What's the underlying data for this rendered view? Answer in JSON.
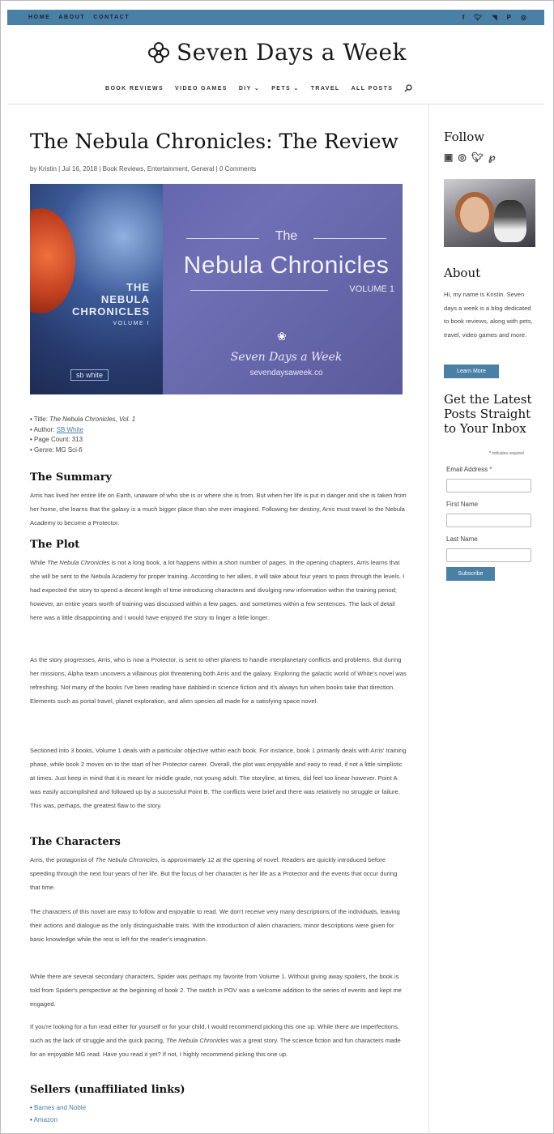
{
  "topbar": {
    "nav": [
      "HOME",
      "ABOUT",
      "CONTACT"
    ],
    "social_icons": [
      "facebook-icon",
      "twitter-icon",
      "rss-icon",
      "pinterest-icon",
      "instagram-icon"
    ]
  },
  "header": {
    "site_title": "Seven Days a Week",
    "nav": [
      "BOOK REVIEWS",
      "VIDEO GAMES",
      "DIY ⌄",
      "PETS ⌄",
      "TRAVEL",
      "ALL POSTS"
    ]
  },
  "article": {
    "title": "The Nebula Chronicles: The Review",
    "meta": {
      "by": "by Kristin",
      "date": "Jul 16, 2018",
      "categories": "Book Reviews, Entertainment, General",
      "comments": "0 Comments"
    },
    "banner": {
      "cover_title_1": "THE",
      "cover_title_2": "NEBULA",
      "cover_title_3": "CHRONICLES",
      "cover_volume": "VOLUME I",
      "cover_author": "sb white",
      "the": "The",
      "name": "Nebula Chronicles",
      "volume": "VOLUME 1",
      "brand": "Seven Days a Week",
      "url": "sevendaysaweek.co"
    },
    "facts": {
      "title_label": "Title: ",
      "title_value": "The Nebula Chronicles, Vol. 1",
      "author_label": "Author: ",
      "author_value": "SB White",
      "pages": "Page Count: 313",
      "genre": "Genre: MG Sci-fi"
    },
    "summary_heading": "The Summary",
    "summary": "Arris has lived her entire life on Earth, unaware of who she is or where she is from. But when her life is put in danger and she is taken from her home, she learns that the galaxy is a much bigger place than she ever imagined. Following her destiny, Arris must travel to the Nebula Academy to become a Protector.",
    "plot_heading": "The Plot",
    "plot_1_pre": "While ",
    "plot_1_italic": "The Nebula Chronicles",
    "plot_1_post": " is not a long book, a lot happens within a short number of pages. In the opening chapters, Arris learns that she will be sent to the Nebula Academy for proper training. According to her allies, it will take about four years to pass through the levels. I had expected the story to spend a decent length of time introducing characters and divulging new information within the training period; however, an entire years worth of training was discussed within a few pages, and sometimes within a few sentences. The lack of detail here was a little disappointing and I would have enjoyed the story to linger a little longer.",
    "plot_2": "As the story progresses, Arris, who is now a Protector, is sent to other planets to handle interplanetary conflicts and problems. But during her missions, Alpha team uncovers a villainous plot threatening both Arris and the galaxy. Exploring the galactic world of White's novel was refreshing. Not many of the books I've been reading have dabbled in science fiction and it's always fun when books take that direction. Elements such as portal travel, planet exploration, and alien species all made for a satisfying space novel.",
    "plot_3": "Sectioned into 3 books, Volume 1 deals with a particular objective within each book. For instance, book 1 primarily deals with Arris' training phase, while book 2 moves on to the start of her Protector career. Overall, the plot was enjoyable and easy to read, if not a little simplistic at times. Just keep in mind that it is meant for middle grade, not young adult. The storyline, at times, did feel too linear however. Point A was easily accomplished and followed up by a successful Point B. The conflicts were brief and there was relatively no struggle or failure. This was, perhaps, the greatest flaw to the story.",
    "characters_heading": "The Characters",
    "char_1_pre": "Arris, the protagonist of ",
    "char_1_italic": "The Nebula Chronicles,",
    "char_1_post": " is approximately 12 at the opening of novel. Readers are quickly introduced before speeding through the next four years of her life. But the focus of her character is her life as a Protector and the events that occur during that time.",
    "char_2": "The characters of this novel are easy to follow and enjoyable to read. We don't receive very many descriptions of the individuals, leaving their actions and dialogue as the only distinguishable traits. With the introduction of alien characters, minor descriptions were given for basic knowledge while the rest is left for the reader's imagination.",
    "char_3": "While there are several secondary characters, Spider was perhaps my favorite from Volume 1. Without giving away spoilers, the book is told from Spider's perspective at the beginning of book 2. The switch in POV was a welcome addition to the series of events and kept me engaged.",
    "char_4_pre": "If you're looking for a fun read either for yourself or for your child, I would recommend picking this one up. While there are imperfections, such as the lack of struggle and the quick pacing, ",
    "char_4_italic": "The Nebula Chronicles",
    "char_4_post": " was a great story. The science fiction and fun characters made for an enjoyable MG read. Have you read it yet? If not, I highly recommend picking this one up.",
    "sellers_heading": "Sellers (unaffiliated links)",
    "sellers": [
      "Barnes and Noble",
      "Amazon"
    ]
  },
  "sidebar": {
    "follow_heading": "Follow",
    "follow_icons": [
      "facebook-icon",
      "instagram-icon",
      "twitter-icon",
      "pinterest-icon"
    ],
    "about_heading": "About",
    "about_text": "Hi, my name is Kristin. Seven days a week is a blog dedicated to book reviews, along with pets, travel, video games and more.",
    "learn_more": "Learn More",
    "newsletter_heading": "Get the Latest Posts Straight to Your Inbox",
    "required_note": "indicates required",
    "email_label": "Email Address ",
    "first_name_label": "First Name",
    "last_name_label": "Last Name",
    "subscribe": "Subscribe"
  },
  "colors": {
    "accent": "#4a7fa6",
    "topbar": "#4a7fa6"
  }
}
